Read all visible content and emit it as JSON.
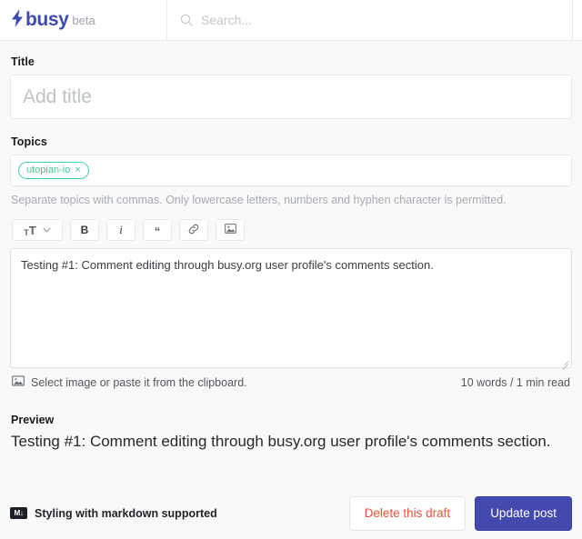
{
  "header": {
    "brand": {
      "bolt_icon": "lightning-bolt-icon",
      "name": "busy",
      "badge": "beta"
    },
    "search": {
      "icon": "search-icon",
      "placeholder": "Search...",
      "value": ""
    }
  },
  "form": {
    "title": {
      "label": "Title",
      "placeholder": "Add title",
      "value": ""
    },
    "topics": {
      "label": "Topics",
      "tags": [
        {
          "text": "utopian-io",
          "remove": "×"
        }
      ],
      "help": "Separate topics with commas. Only lowercase letters, numbers and hyphen character is permitted.",
      "tag_color": "#3ccd92"
    },
    "toolbar": [
      {
        "name": "text-size-button",
        "small_t": "T",
        "big_t": "T",
        "chevron": "⌄"
      },
      {
        "name": "bold-button",
        "label": "B"
      },
      {
        "name": "italic-button",
        "label": "i"
      },
      {
        "name": "quote-button",
        "label": "“"
      },
      {
        "name": "link-button",
        "label": "link-icon"
      },
      {
        "name": "image-button",
        "label": "image-icon"
      }
    ],
    "editor": {
      "value": "Testing #1: Comment editing through busy.org user profile's comments section.",
      "image_hint": "Select image or paste it from the clipboard.",
      "word_count": "10 words / 1 min read"
    }
  },
  "preview": {
    "label": "Preview",
    "body": "Testing #1: Comment editing through busy.org user profile's comments section."
  },
  "footer": {
    "markdown_icon": "M↓",
    "markdown_text": "Styling with markdown supported",
    "delete_label": "Delete this draft",
    "update_label": "Update post",
    "delete_color": "#f4503a",
    "update_color": "#4349ad"
  }
}
